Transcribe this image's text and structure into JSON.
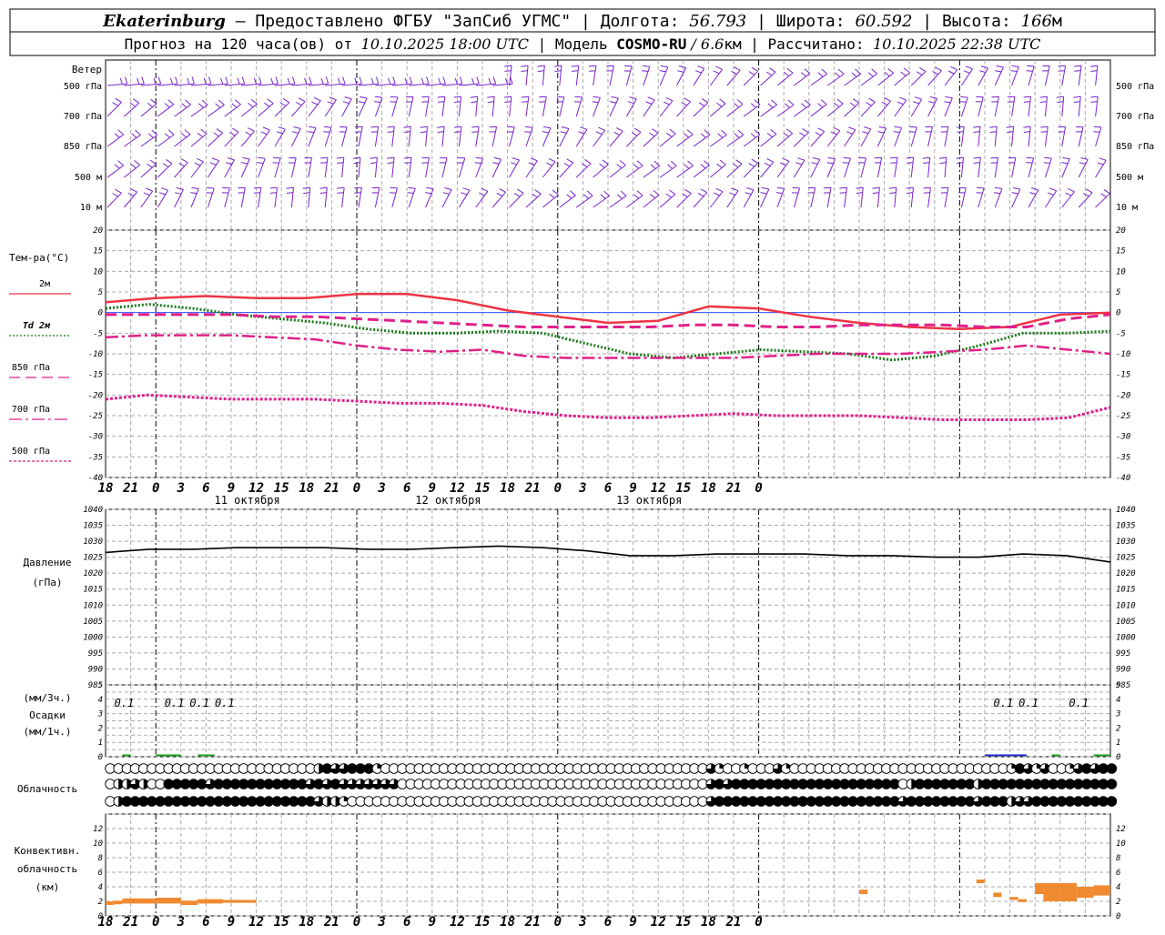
{
  "header": {
    "line1": {
      "station": "Ekaterinburg",
      "provider": " – Предоставлено ФГБУ \"ЗапСиб УГМС\" | Долгота: ",
      "lon": "56.793",
      "lat_label": " | Широта: ",
      "lat": "60.592",
      "alt_label": " | Высота: ",
      "alt": "166",
      "alt_unit": "м"
    },
    "line2": {
      "forecast": "Прогноз на 120 часа(ов) от ",
      "from": "10.10.2025 18:00 UTC",
      "model_label": "  | Модель ",
      "model": "COSMO-RU",
      "model_res": " / 6.6",
      "res_unit": "км",
      "calc_label": " | Рассчитано: ",
      "calc": "10.10.2025 22:38 UTC"
    }
  },
  "panels": {
    "wind": {
      "title": "Ветер",
      "levels": [
        "500 гПа",
        "700 гПа",
        "850 гПа",
        "500 м",
        "10  м"
      ],
      "right_levels": [
        "500 гПа",
        "700 гПа",
        "850 гПа",
        "500 м",
        "10  м"
      ],
      "color": "#7a22cc"
    },
    "temp": {
      "title": "Тем-ра(°C)",
      "legend": [
        {
          "label": "2м",
          "color": "#ee3344",
          "style": "solid"
        },
        {
          "label": "Td  2м",
          "color": "#1a7a1a",
          "style": "dotted"
        },
        {
          "label": "850 гПа",
          "color": "#e0208a",
          "style": "dash"
        },
        {
          "label": "700 гПа",
          "color": "#e0208a",
          "style": "dashdot"
        },
        {
          "label": "500 гПа",
          "color": "#e0208a",
          "style": "dot"
        }
      ]
    },
    "pressure": {
      "title": "Давление",
      "unit": "(гПа)"
    },
    "precip": {
      "unit1": "(мм/3ч.)",
      "title": "Осадки",
      "unit2": "(мм/1ч.)"
    },
    "cloud": {
      "title": "Облачность"
    },
    "conv": {
      "title1": "Конвективн.",
      "title2": "облачность",
      "unit": "(км)"
    }
  },
  "time_axis": {
    "hours": [
      "18",
      "21",
      "0",
      "3",
      "6",
      "9",
      "12",
      "15",
      "18",
      "21",
      "0",
      "3",
      "6",
      "9",
      "12",
      "15",
      "18",
      "21",
      "0",
      "3",
      "6",
      "9",
      "12",
      "15",
      "18",
      "21",
      "0"
    ],
    "dates": [
      "11 октября",
      "12 октября",
      "13 октября"
    ]
  },
  "chart_data": [
    {
      "type": "line",
      "name": "temperature",
      "x_hours": [
        0,
        6,
        12,
        18,
        24,
        30,
        36,
        42,
        48,
        54,
        60,
        66,
        72,
        78,
        84,
        90,
        96,
        102,
        108,
        114,
        120
      ],
      "ylim": [
        -40,
        20
      ],
      "yticks": [
        20,
        15,
        10,
        5,
        0,
        -5,
        -10,
        -15,
        -20,
        -25,
        -30,
        -35,
        -40
      ],
      "series": [
        {
          "name": "2м",
          "values": [
            2.5,
            3.5,
            4,
            3.5,
            3.5,
            4.5,
            4.5,
            3,
            0.5,
            -1,
            -2.5,
            -2,
            1.5,
            1,
            -1,
            -2.5,
            -3.5,
            -4,
            -3.5,
            -0.5,
            0
          ]
        },
        {
          "name": "Td  2м",
          "values": [
            1,
            2,
            1,
            -0.5,
            -1.5,
            -2.5,
            -4,
            -5,
            -5,
            -4.5,
            -5,
            -7.5,
            -10,
            -11,
            -10,
            -9,
            -9.5,
            -10,
            -11.5,
            -10.5,
            -8,
            -5,
            -5,
            -4.5
          ]
        },
        {
          "name": "850 гПа",
          "values": [
            -0.5,
            -0.5,
            -0.5,
            -0.5,
            -1,
            -1,
            -1.5,
            -2,
            -2.5,
            -3,
            -3.5,
            -3.5,
            -3.5,
            -3.5,
            -3,
            -3,
            -3.5,
            -3.5,
            -3,
            -3,
            -3,
            -3.5,
            -3.5,
            -1.5,
            -0.5
          ]
        },
        {
          "name": "700 гПа",
          "values": [
            -6,
            -5.5,
            -5.5,
            -5.5,
            -6,
            -6.5,
            -8,
            -9,
            -9.5,
            -9,
            -10.5,
            -11,
            -11,
            -11,
            -11,
            -11,
            -10.5,
            -10,
            -10,
            -10,
            -9.5,
            -9,
            -8,
            -9,
            -10
          ]
        },
        {
          "name": "500 гПа",
          "values": [
            -21,
            -20,
            -20.5,
            -21,
            -21,
            -21,
            -21.5,
            -22,
            -22,
            -22.5,
            -24,
            -25,
            -25.5,
            -25.5,
            -25,
            -24.5,
            -25,
            -25,
            -25,
            -25.5,
            -26,
            -26,
            -26,
            -25.5,
            -23
          ]
        }
      ]
    },
    {
      "type": "line",
      "name": "pressure",
      "ylim": [
        985,
        1040
      ],
      "yticks": [
        1040,
        1035,
        1030,
        1025,
        1020,
        1015,
        1010,
        1005,
        1000,
        995,
        990,
        985
      ],
      "series": [
        {
          "name": "",
          "values": [
            1026.5,
            1027.5,
            1027.5,
            1028,
            1028,
            1028,
            1027.5,
            1027.5,
            1028,
            1028.5,
            1028,
            1027,
            1025.5,
            1025.5,
            1026,
            1026,
            1026,
            1025.5,
            1025.5,
            1025,
            1025,
            1026,
            1025.5,
            1023.5
          ]
        }
      ]
    },
    {
      "type": "bar",
      "name": "precipitation",
      "ylim": [
        0,
        5
      ],
      "yticks": [
        5,
        4,
        3,
        2,
        1,
        0
      ],
      "labels": [
        {
          "hour": 2,
          "text": "0.1"
        },
        {
          "hour": 8,
          "text": "0.1"
        },
        {
          "hour": 11,
          "text": "0.1"
        },
        {
          "hour": 14,
          "text": "0.1"
        },
        {
          "hour": 107,
          "text": "0.1"
        },
        {
          "hour": 110,
          "text": "0.1"
        },
        {
          "hour": 116,
          "text": "0.1"
        }
      ],
      "bars": [
        {
          "from": 2,
          "to": 3,
          "value": 0.1,
          "color": "#20a020"
        },
        {
          "from": 6,
          "to": 9,
          "value": 0.1,
          "color": "#20a020"
        },
        {
          "from": 11,
          "to": 13,
          "value": 0.1,
          "color": "#20a020"
        },
        {
          "from": 105,
          "to": 108,
          "value": 0.1,
          "color": "#2030cc"
        },
        {
          "from": 108,
          "to": 110,
          "value": 0.1,
          "color": "#2030cc"
        },
        {
          "from": 113,
          "to": 114,
          "value": 0.1,
          "color": "#20a020"
        },
        {
          "from": 118,
          "to": 120,
          "value": 0.1,
          "color": "#20a020"
        }
      ]
    },
    {
      "type": "bar",
      "name": "convective_cloud",
      "ylim": [
        0,
        14
      ],
      "yticks": [
        12,
        10,
        8,
        6,
        4,
        2,
        0
      ],
      "color": "#f08a30",
      "bars": [
        {
          "from": 0,
          "to": 1,
          "base": 1.5,
          "top": 2
        },
        {
          "from": 1,
          "to": 2,
          "base": 1.6,
          "top": 2.1
        },
        {
          "from": 2,
          "to": 6,
          "base": 1.7,
          "top": 2.4
        },
        {
          "from": 6,
          "to": 9,
          "base": 1.7,
          "top": 2.5
        },
        {
          "from": 9,
          "to": 11,
          "base": 1.5,
          "top": 2.1
        },
        {
          "from": 11,
          "to": 14,
          "base": 1.7,
          "top": 2.3
        },
        {
          "from": 14,
          "to": 18,
          "base": 1.8,
          "top": 2.2
        },
        {
          "from": 90,
          "to": 91,
          "base": 3,
          "top": 3.6
        },
        {
          "from": 104,
          "to": 105,
          "base": 4.5,
          "top": 5
        },
        {
          "from": 106,
          "to": 107,
          "base": 2.6,
          "top": 3.2
        },
        {
          "from": 108,
          "to": 109,
          "base": 2.2,
          "top": 2.6
        },
        {
          "from": 109,
          "to": 110,
          "base": 1.9,
          "top": 2.3
        },
        {
          "from": 111,
          "to": 112,
          "base": 3,
          "top": 4.5
        },
        {
          "from": 112,
          "to": 114,
          "base": 2,
          "top": 4.5
        },
        {
          "from": 114,
          "to": 116,
          "base": 2,
          "top": 4.5
        },
        {
          "from": 116,
          "to": 118,
          "base": 2.5,
          "top": 4
        },
        {
          "from": 118,
          "to": 120,
          "base": 2.8,
          "top": 4.2
        }
      ]
    },
    {
      "type": "table",
      "name": "cloud_cover",
      "rows": [
        "0000000000000000000000000263344410000000000000000000000000000000000000003100100031000000000000000000000000001431300134344",
        "0223200444443444444444443434333333300000000000000000000000000000000000003434444444444444444444402444444424444444444444444",
        "0244444444444444444444444322100000000000000000000000000000000000000000003444444444444444444444434444444434442334444444444"
      ]
    }
  ]
}
